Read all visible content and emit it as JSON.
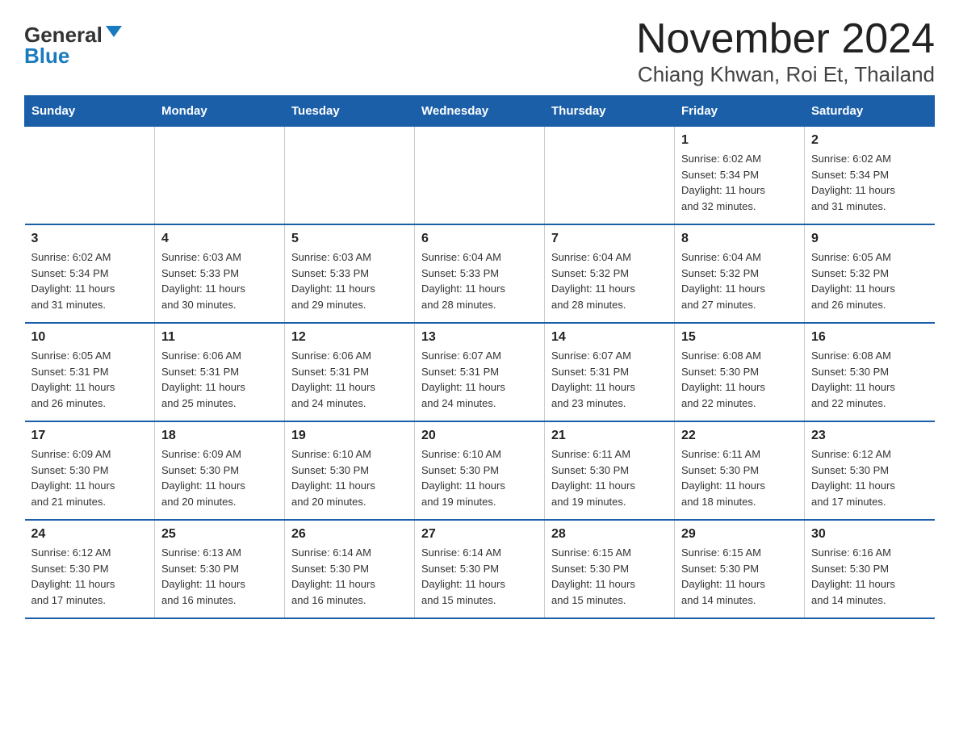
{
  "logo": {
    "general": "General",
    "blue": "Blue"
  },
  "title": "November 2024",
  "subtitle": "Chiang Khwan, Roi Et, Thailand",
  "days_of_week": [
    "Sunday",
    "Monday",
    "Tuesday",
    "Wednesday",
    "Thursday",
    "Friday",
    "Saturday"
  ],
  "weeks": [
    [
      {
        "day": "",
        "info": ""
      },
      {
        "day": "",
        "info": ""
      },
      {
        "day": "",
        "info": ""
      },
      {
        "day": "",
        "info": ""
      },
      {
        "day": "",
        "info": ""
      },
      {
        "day": "1",
        "info": "Sunrise: 6:02 AM\nSunset: 5:34 PM\nDaylight: 11 hours\nand 32 minutes."
      },
      {
        "day": "2",
        "info": "Sunrise: 6:02 AM\nSunset: 5:34 PM\nDaylight: 11 hours\nand 31 minutes."
      }
    ],
    [
      {
        "day": "3",
        "info": "Sunrise: 6:02 AM\nSunset: 5:34 PM\nDaylight: 11 hours\nand 31 minutes."
      },
      {
        "day": "4",
        "info": "Sunrise: 6:03 AM\nSunset: 5:33 PM\nDaylight: 11 hours\nand 30 minutes."
      },
      {
        "day": "5",
        "info": "Sunrise: 6:03 AM\nSunset: 5:33 PM\nDaylight: 11 hours\nand 29 minutes."
      },
      {
        "day": "6",
        "info": "Sunrise: 6:04 AM\nSunset: 5:33 PM\nDaylight: 11 hours\nand 28 minutes."
      },
      {
        "day": "7",
        "info": "Sunrise: 6:04 AM\nSunset: 5:32 PM\nDaylight: 11 hours\nand 28 minutes."
      },
      {
        "day": "8",
        "info": "Sunrise: 6:04 AM\nSunset: 5:32 PM\nDaylight: 11 hours\nand 27 minutes."
      },
      {
        "day": "9",
        "info": "Sunrise: 6:05 AM\nSunset: 5:32 PM\nDaylight: 11 hours\nand 26 minutes."
      }
    ],
    [
      {
        "day": "10",
        "info": "Sunrise: 6:05 AM\nSunset: 5:31 PM\nDaylight: 11 hours\nand 26 minutes."
      },
      {
        "day": "11",
        "info": "Sunrise: 6:06 AM\nSunset: 5:31 PM\nDaylight: 11 hours\nand 25 minutes."
      },
      {
        "day": "12",
        "info": "Sunrise: 6:06 AM\nSunset: 5:31 PM\nDaylight: 11 hours\nand 24 minutes."
      },
      {
        "day": "13",
        "info": "Sunrise: 6:07 AM\nSunset: 5:31 PM\nDaylight: 11 hours\nand 24 minutes."
      },
      {
        "day": "14",
        "info": "Sunrise: 6:07 AM\nSunset: 5:31 PM\nDaylight: 11 hours\nand 23 minutes."
      },
      {
        "day": "15",
        "info": "Sunrise: 6:08 AM\nSunset: 5:30 PM\nDaylight: 11 hours\nand 22 minutes."
      },
      {
        "day": "16",
        "info": "Sunrise: 6:08 AM\nSunset: 5:30 PM\nDaylight: 11 hours\nand 22 minutes."
      }
    ],
    [
      {
        "day": "17",
        "info": "Sunrise: 6:09 AM\nSunset: 5:30 PM\nDaylight: 11 hours\nand 21 minutes."
      },
      {
        "day": "18",
        "info": "Sunrise: 6:09 AM\nSunset: 5:30 PM\nDaylight: 11 hours\nand 20 minutes."
      },
      {
        "day": "19",
        "info": "Sunrise: 6:10 AM\nSunset: 5:30 PM\nDaylight: 11 hours\nand 20 minutes."
      },
      {
        "day": "20",
        "info": "Sunrise: 6:10 AM\nSunset: 5:30 PM\nDaylight: 11 hours\nand 19 minutes."
      },
      {
        "day": "21",
        "info": "Sunrise: 6:11 AM\nSunset: 5:30 PM\nDaylight: 11 hours\nand 19 minutes."
      },
      {
        "day": "22",
        "info": "Sunrise: 6:11 AM\nSunset: 5:30 PM\nDaylight: 11 hours\nand 18 minutes."
      },
      {
        "day": "23",
        "info": "Sunrise: 6:12 AM\nSunset: 5:30 PM\nDaylight: 11 hours\nand 17 minutes."
      }
    ],
    [
      {
        "day": "24",
        "info": "Sunrise: 6:12 AM\nSunset: 5:30 PM\nDaylight: 11 hours\nand 17 minutes."
      },
      {
        "day": "25",
        "info": "Sunrise: 6:13 AM\nSunset: 5:30 PM\nDaylight: 11 hours\nand 16 minutes."
      },
      {
        "day": "26",
        "info": "Sunrise: 6:14 AM\nSunset: 5:30 PM\nDaylight: 11 hours\nand 16 minutes."
      },
      {
        "day": "27",
        "info": "Sunrise: 6:14 AM\nSunset: 5:30 PM\nDaylight: 11 hours\nand 15 minutes."
      },
      {
        "day": "28",
        "info": "Sunrise: 6:15 AM\nSunset: 5:30 PM\nDaylight: 11 hours\nand 15 minutes."
      },
      {
        "day": "29",
        "info": "Sunrise: 6:15 AM\nSunset: 5:30 PM\nDaylight: 11 hours\nand 14 minutes."
      },
      {
        "day": "30",
        "info": "Sunrise: 6:16 AM\nSunset: 5:30 PM\nDaylight: 11 hours\nand 14 minutes."
      }
    ]
  ]
}
